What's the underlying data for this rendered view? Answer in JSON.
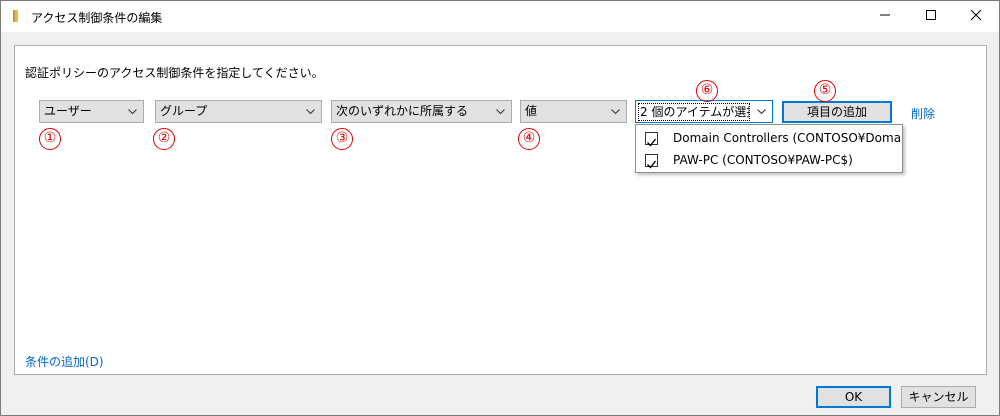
{
  "window": {
    "title": "アクセス制御条件の編集"
  },
  "instruction": "認証ポリシーのアクセス制御条件を指定してください。",
  "condition": {
    "user_combo": "ユーザー",
    "group_combo": "グループ",
    "operator_combo": "次のいずれかに所属する",
    "value_combo": "値",
    "items_combo": "2 個のアイテムが選択...",
    "add_item_button": "項目の追加",
    "delete_link": "削除"
  },
  "dropdown": {
    "items": [
      {
        "label": "Domain Controllers (CONTOSO¥Doma...",
        "checked": true
      },
      {
        "label": "PAW-PC (CONTOSO¥PAW-PC$)",
        "checked": true
      }
    ]
  },
  "markers": [
    "①",
    "②",
    "③",
    "④",
    "⑤",
    "⑥"
  ],
  "add_condition_link": "条件の追加(D)",
  "buttons": {
    "ok": "OK",
    "cancel": "キャンセル"
  },
  "colors": {
    "marker": "#e60000",
    "link": "#0066cc",
    "focus": "#0078d7"
  }
}
